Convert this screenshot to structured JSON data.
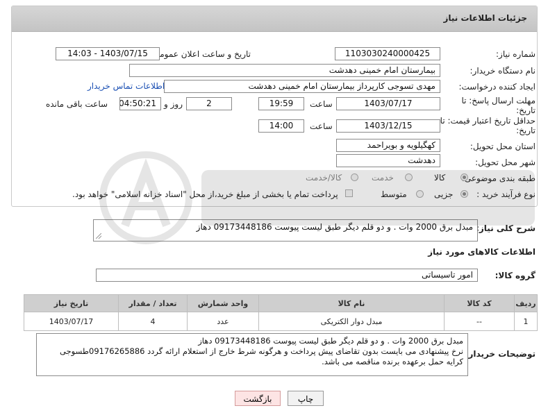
{
  "header": {
    "title": "جزئیات اطلاعات نیاز"
  },
  "need_number": {
    "label": "شماره نیاز:",
    "value": "1103030240000425"
  },
  "announce_datetime": {
    "label": "تاریخ و ساعت اعلان عمومی:",
    "value": "1403/07/15 - 14:03"
  },
  "buyer_org": {
    "label": "نام دستگاه خریدار:",
    "value": "بیمارستان امام خمینی دهدشت"
  },
  "requester": {
    "label": "ایجاد کننده درخواست:",
    "value": "مهدی تسوجی کارپرداز بیمارستان امام خمینی دهدشت",
    "contact_link": "اطلاعات تماس خریدار"
  },
  "reply_deadline": {
    "label_line1": "مهلت ارسال پاسخ: تا",
    "label_line2": "تاریخ:",
    "date": "1403/07/17",
    "time_label": "ساعت",
    "time": "19:59",
    "days": "2",
    "days_label": "روز و",
    "remaining": "04:50:21",
    "remaining_label": "ساعت باقی مانده"
  },
  "price_validity": {
    "label_line1": "حداقل تاریخ اعتبار قیمت: تا",
    "label_line2": "تاریخ:",
    "date": "1403/12/15",
    "time_label": "ساعت",
    "time": "14:00"
  },
  "delivery_province": {
    "label": "استان محل تحویل:",
    "value": "کهگیلویه و بویراحمد"
  },
  "delivery_city": {
    "label": "شهر محل تحویل:",
    "value": "دهدشت"
  },
  "category": {
    "label": "طبقه بندی موضوعی:",
    "options": [
      "کالا",
      "خدمت",
      "کالا/خدمت"
    ],
    "selected": "کالا"
  },
  "purchase_type": {
    "label": "نوع فرآیند خرید :",
    "options": [
      "جزیی",
      "متوسط"
    ],
    "selected": "جزیی",
    "payment_note": "پرداخت تمام یا بخشی از مبلغ خرید،از محل \"اسناد خزانه اسلامی\" خواهد بود."
  },
  "description": {
    "label": "شرح کلی نیاز:",
    "value": "مبدل برق 2000 وات .  و دو قلم دیگر طبق لیست پیوست 09173448186 دهاز"
  },
  "goods_info": {
    "title": "اطلاعات کالاهای مورد نیاز"
  },
  "goods_group": {
    "label": "گروه کالا:",
    "value": "امور تاسیساتی"
  },
  "table": {
    "headers": [
      "ردیف",
      "کد کالا",
      "نام کالا",
      "واحد شمارش",
      "تعداد / مقدار",
      "تاریخ نیاز"
    ],
    "rows": [
      [
        "1",
        "--",
        "مبدل دوار الکتریکی",
        "عدد",
        "4",
        "1403/07/17"
      ]
    ]
  },
  "buyer_notes": {
    "label": "توضیحات خریدار:",
    "line1": "مبدل برق 2000 وات .  و دو قلم دیگر طبق لیست پیوست 09173448186 دهاز",
    "line2": "نرخ پیشنهادی می بایست بدون تقاضای پیش پرداخت و هرگونه شرط خارج از استعلام ارائه گردد 09176265886طسوجی",
    "line3": "کرایه حمل برعهده برنده مناقصه می باشد."
  },
  "buttons": {
    "print": "چاپ",
    "back": "بازگشت"
  },
  "colors": {
    "header_bg": "#c9c9c9",
    "link": "#1a4fb3",
    "back_button_bg": "#fde4e4"
  }
}
